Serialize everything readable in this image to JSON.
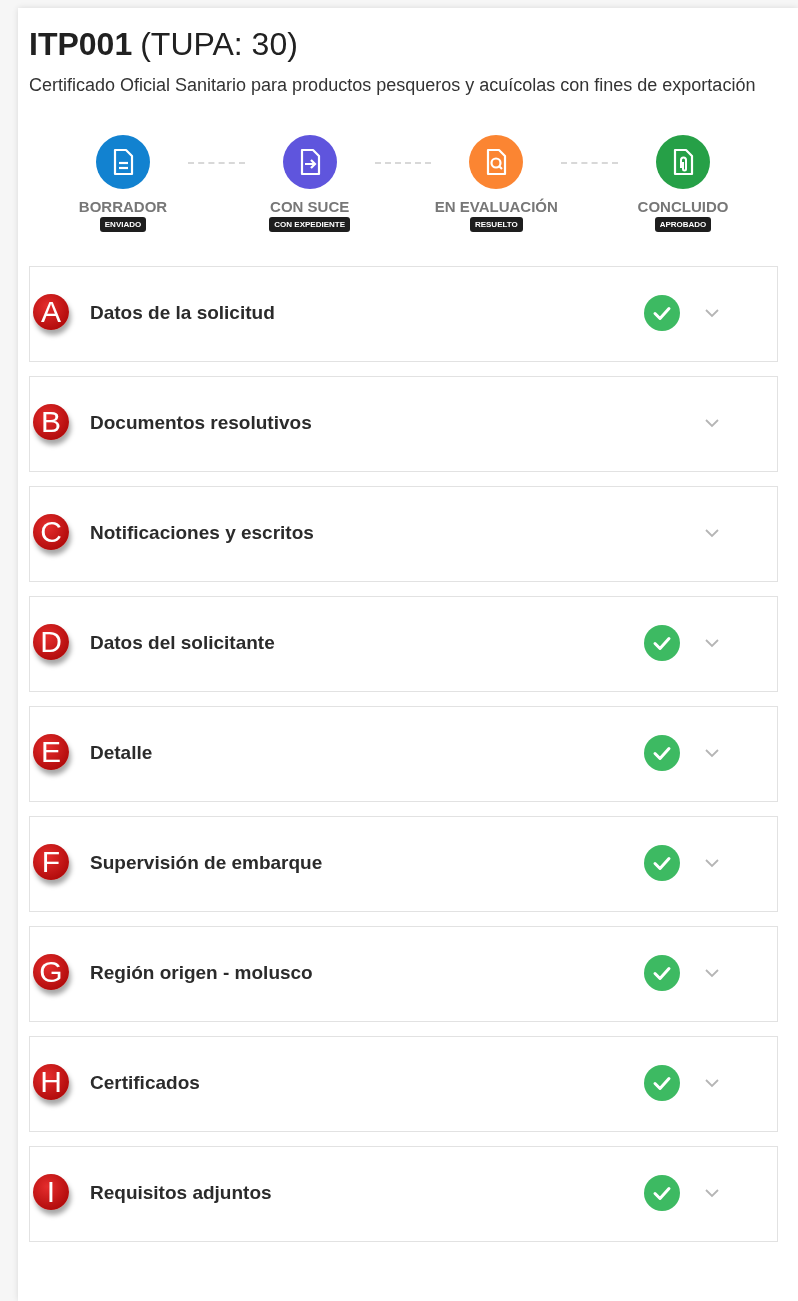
{
  "header": {
    "code": "ITP001",
    "tupa": "(TUPA: 30)",
    "description": "Certificado Oficial Sanitario para productos pesqueros y acuícolas con fines de exportación"
  },
  "steps": [
    {
      "kind": "draft",
      "label": "BORRADOR",
      "badge": "ENVIADO",
      "color": "#1282d0"
    },
    {
      "kind": "submit",
      "label": "CON SUCE",
      "badge": "CON EXPEDIENTE",
      "color": "#5f55dd"
    },
    {
      "kind": "review",
      "label": "EN EVALUACIÓN",
      "badge": "RESUELTO",
      "color": "#fb8532"
    },
    {
      "kind": "done",
      "label": "CONCLUIDO",
      "badge": "APROBADO",
      "color": "#26a047"
    }
  ],
  "sections": [
    {
      "marker": "A",
      "title": "Datos de la solicitud",
      "complete": true
    },
    {
      "marker": "B",
      "title": "Documentos resolutivos",
      "complete": false
    },
    {
      "marker": "C",
      "title": "Notificaciones y escritos",
      "complete": false
    },
    {
      "marker": "D",
      "title": "Datos del solicitante",
      "complete": true
    },
    {
      "marker": "E",
      "title": "Detalle",
      "complete": true
    },
    {
      "marker": "F",
      "title": "Supervisión de embarque",
      "complete": true
    },
    {
      "marker": "G",
      "title": "Región origen - molusco",
      "complete": true
    },
    {
      "marker": "H",
      "title": "Certificados",
      "complete": true
    },
    {
      "marker": "I",
      "title": "Requisitos adjuntos",
      "complete": true
    }
  ]
}
